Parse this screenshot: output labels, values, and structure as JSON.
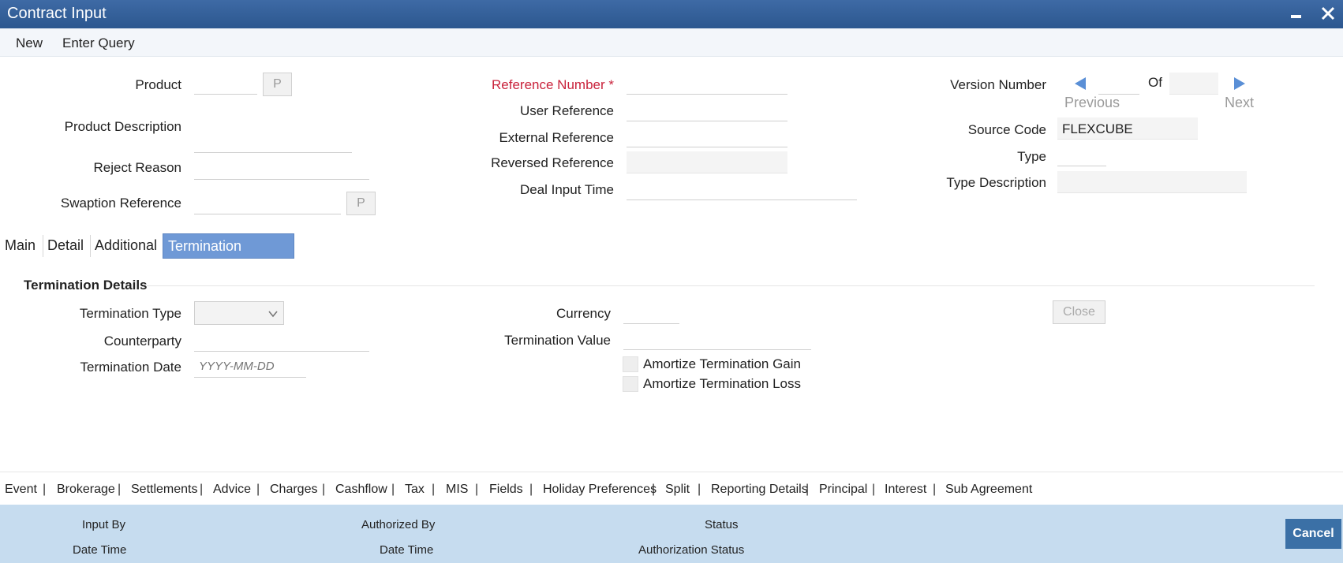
{
  "window": {
    "title": "Contract Input",
    "minimize_icon": "minimize-icon",
    "close_icon": "close-icon"
  },
  "menu": {
    "new": "New",
    "enter_query": "Enter Query"
  },
  "header": {
    "product_label": "Product",
    "product_value": "",
    "p_button": "P",
    "product_description_label": "Product Description",
    "reject_reason_label": "Reject Reason",
    "swaption_reference_label": "Swaption Reference",
    "reference_number_label": "Reference Number",
    "required_mark": "*",
    "user_reference_label": "User Reference",
    "external_reference_label": "External Reference",
    "reversed_reference_label": "Reversed Reference",
    "deal_input_time_label": "Deal Input Time",
    "version_number_label": "Version Number",
    "of_label": "Of",
    "previous_label": "Previous",
    "next_label": "Next",
    "source_code_label": "Source Code",
    "source_code_value": "FLEXCUBE",
    "type_label": "Type",
    "type_description_label": "Type Description"
  },
  "tabs": [
    {
      "label": "Main",
      "active": false
    },
    {
      "label": "Detail",
      "active": false
    },
    {
      "label": "Additional",
      "active": false
    },
    {
      "label": "Termination Details",
      "active": true
    }
  ],
  "termination": {
    "section_title": "Termination Details",
    "termination_type_label": "Termination Type",
    "counterparty_label": "Counterparty",
    "termination_date_label": "Termination Date",
    "termination_date_placeholder": "YYYY-MM-DD",
    "currency_label": "Currency",
    "termination_value_label": "Termination Value",
    "amortize_gain_label": "Amortize Termination Gain",
    "amortize_loss_label": "Amortize Termination Loss",
    "close_button": "Close"
  },
  "links": [
    "Event",
    "Brokerage",
    "Settlements",
    "Advice",
    "Charges",
    "Cashflow",
    "Tax",
    "MIS",
    "Fields",
    "Holiday Preferences",
    "Split",
    "Reporting Details",
    "Principal",
    "Interest",
    "Sub Agreement"
  ],
  "footer": {
    "input_by": "Input By",
    "date_time_1": "Date Time",
    "authorized_by": "Authorized By",
    "date_time_2": "Date Time",
    "status": "Status",
    "authorization_status": "Authorization Status",
    "cancel": "Cancel"
  },
  "colors": {
    "titlebar": "#2c578f",
    "active_tab": "#6f99d6",
    "required": "#c9233c",
    "footer": "#c6dcef",
    "cancel": "#3b70a6",
    "nav_arrow": "#5a8fd6"
  }
}
